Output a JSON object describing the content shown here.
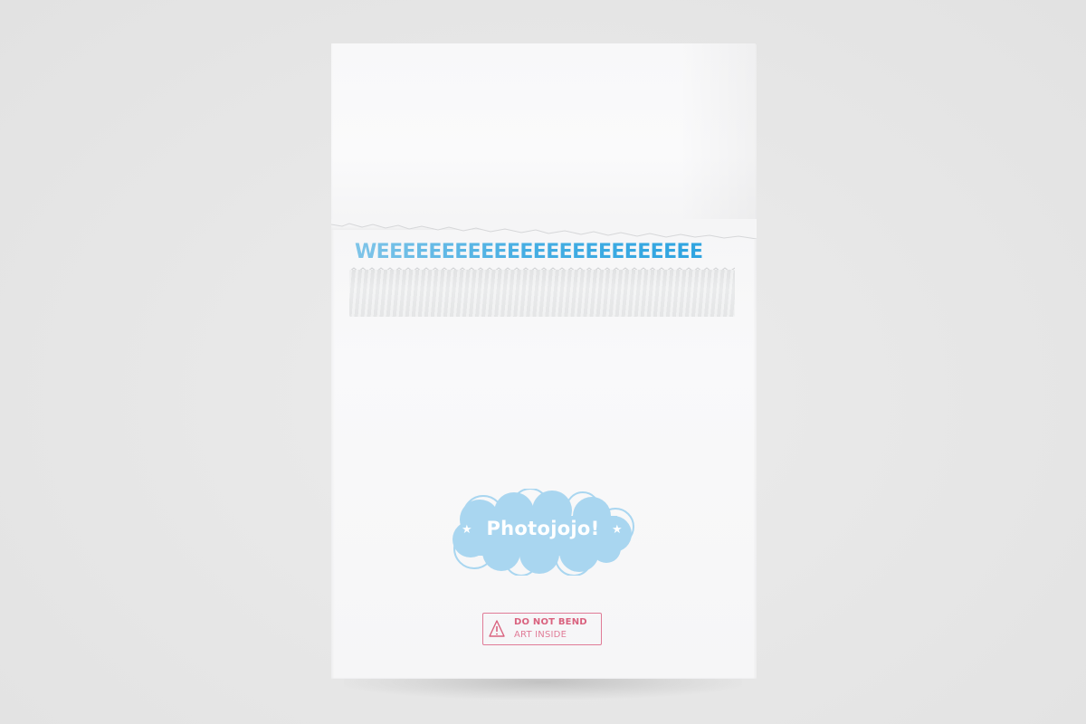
{
  "scene": {
    "background_color": "#e8e8e8",
    "envelope_color": "#f7f7f8"
  },
  "envelope": {
    "banner_text": "WEEEEEEEEEEEEEEEEEEEEEEEEE",
    "banner_color": "#3aa9e2",
    "logo": {
      "text": "Photojojo!",
      "cloud_color": "#a9d6f0",
      "star_glyph": "★"
    },
    "warning_label": {
      "line1": "DO NOT BEND",
      "line2": "ART INSIDE",
      "color": "#d9627f",
      "icon": "warning-triangle-icon"
    }
  }
}
